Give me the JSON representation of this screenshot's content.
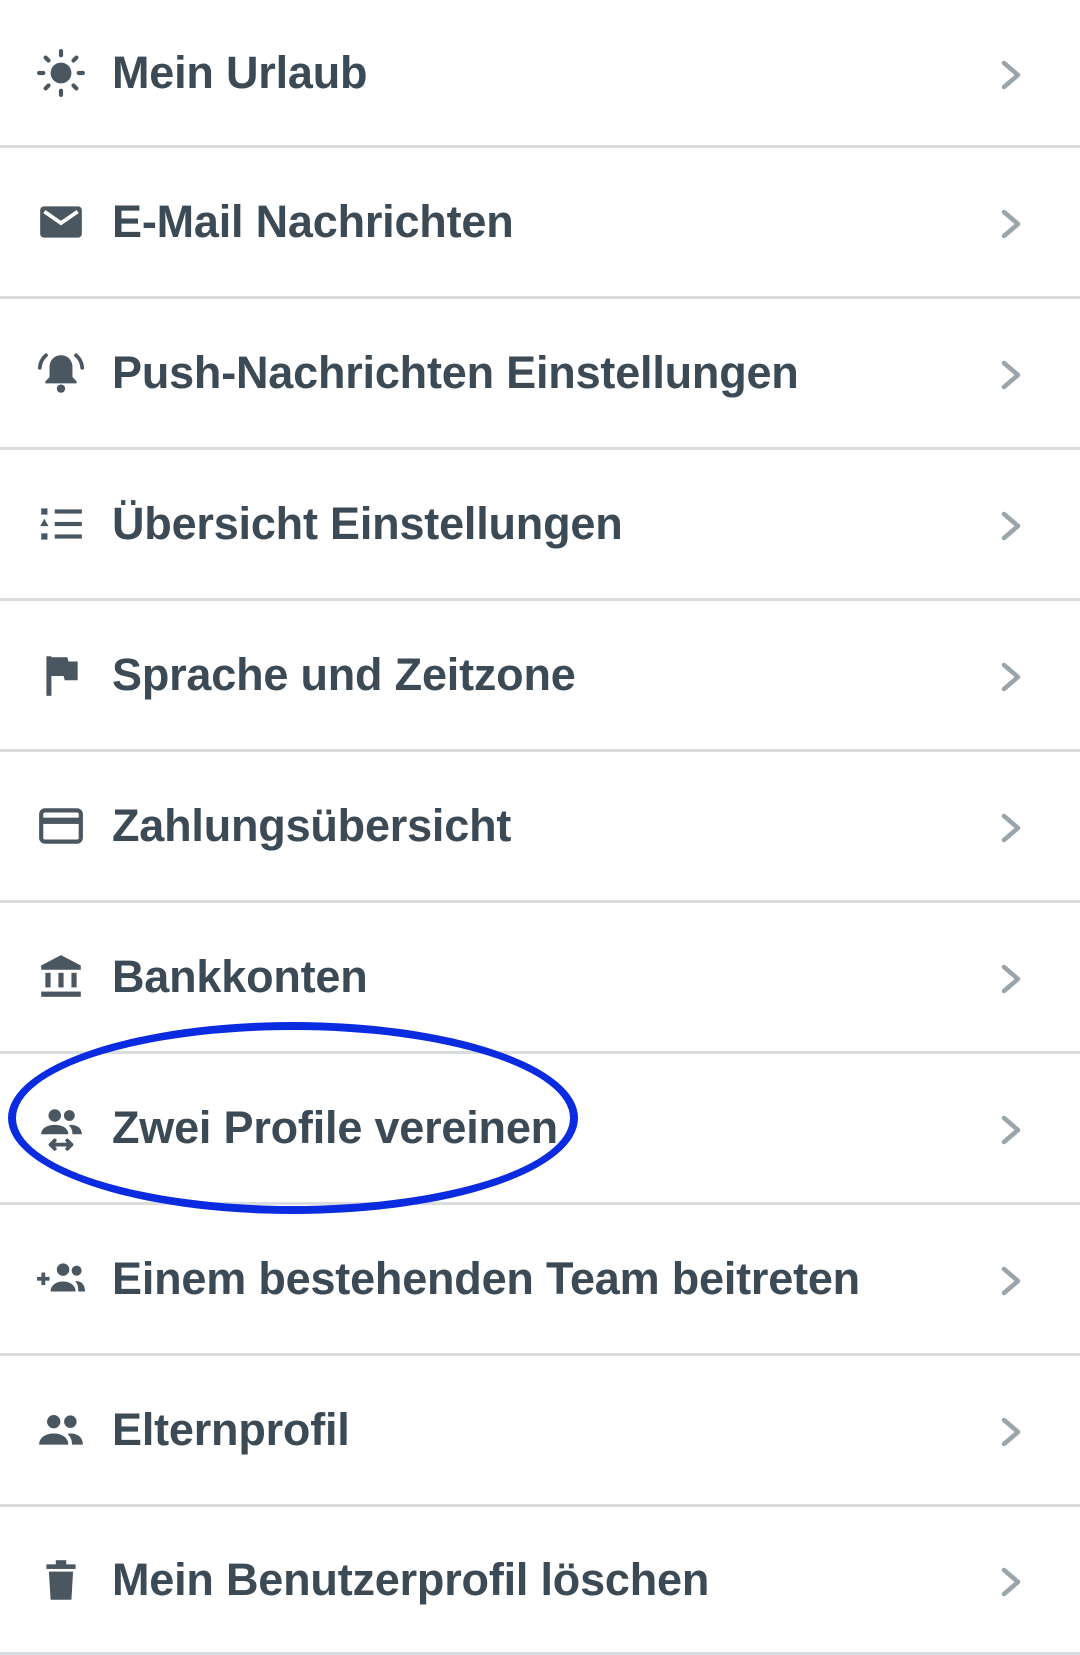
{
  "menu": {
    "items": [
      {
        "id": "mein-urlaub",
        "icon": "sun-icon",
        "label": "Mein Urlaub"
      },
      {
        "id": "email",
        "icon": "mail-icon",
        "label": "E-Mail Nachrichten"
      },
      {
        "id": "push",
        "icon": "bell-ring-icon",
        "label": "Push-Nachrichten Einstellungen"
      },
      {
        "id": "uebersicht",
        "icon": "list-settings-icon",
        "label": "Übersicht Einstellungen"
      },
      {
        "id": "sprache",
        "icon": "flag-icon",
        "label": "Sprache und Zeitzone"
      },
      {
        "id": "zahlung",
        "icon": "credit-card-icon",
        "label": "Zahlungsübersicht"
      },
      {
        "id": "bankkonten",
        "icon": "bank-icon",
        "label": "Bankkonten"
      },
      {
        "id": "profile-vereinen",
        "icon": "merge-people-icon",
        "label": "Zwei Profile vereinen"
      },
      {
        "id": "team-beitreten",
        "icon": "add-group-icon",
        "label": "Einem bestehenden Team beitreten"
      },
      {
        "id": "elternprofil",
        "icon": "people-icon",
        "label": "Elternprofil"
      },
      {
        "id": "profil-loeschen",
        "icon": "trash-icon",
        "label": "Mein Benutzerprofil löschen"
      }
    ]
  },
  "colors": {
    "text": "#3c4a55",
    "icon": "#4a5660",
    "chevron": "#9aa4ab",
    "divider": "#dadddf",
    "highlight": "#0a2be0"
  }
}
